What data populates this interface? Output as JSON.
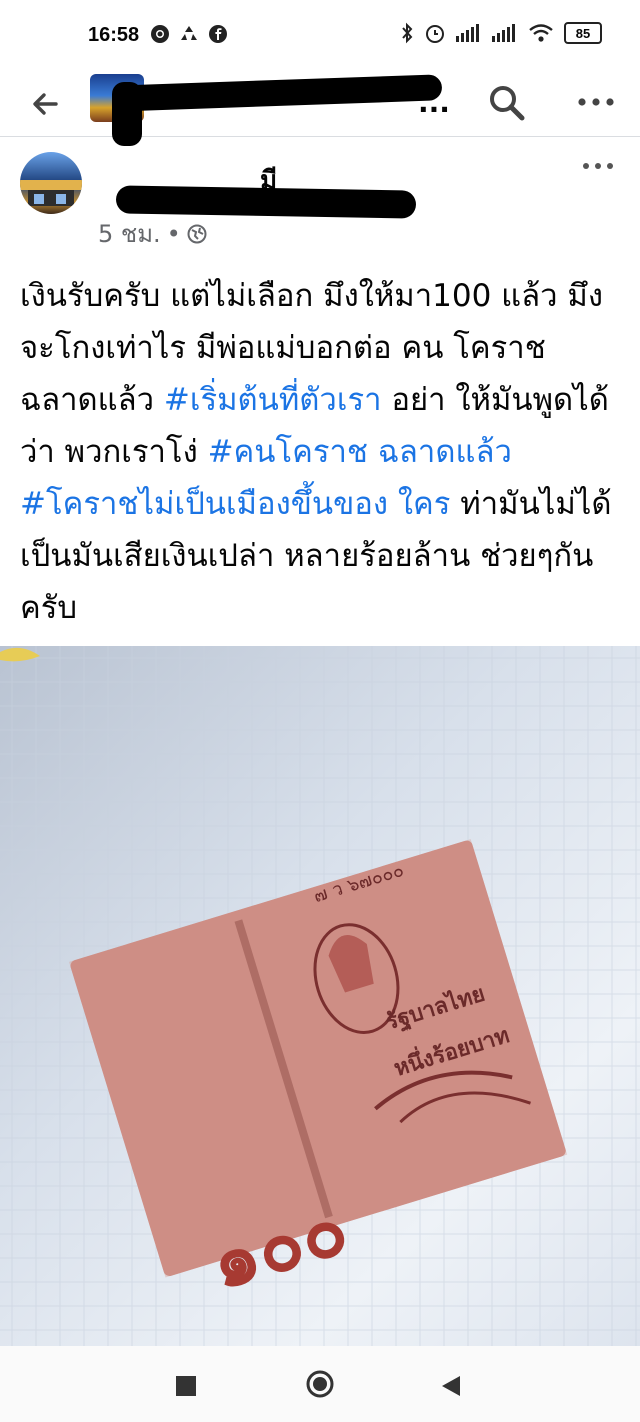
{
  "status_bar": {
    "time": "16:58",
    "battery": "85",
    "left_icons": [
      "chrome-icon",
      "recycle-icon",
      "facebook-icon"
    ],
    "right_icons": [
      "bluetooth-icon",
      "alarm-icon",
      "signal-icon",
      "signal-icon",
      "wifi-icon",
      "battery-icon"
    ]
  },
  "app_bar": {
    "title": "...",
    "back_icon": "arrow-left-icon",
    "search_icon": "search-icon",
    "more_icon": "more-horizontal-icon"
  },
  "post": {
    "author": "มี",
    "time_ago": "5 ชม.",
    "separator": "•",
    "audience_icon": "globe-icon",
    "more_icon": "more-horizontal-icon",
    "text_segments": [
      {
        "text": "เงินรับครับ แต่ไม่เลือก มึงให้มา100 แล้ว มึงจะโกงเท่าไร มีพ่อแม่บอกต่อ คน โคราช ฉลาดแล้ว ",
        "tag": false
      },
      {
        "text": "#เริ่มต้นที่ตัวเรา",
        "tag": true
      },
      {
        "text": "  อย่า ให้มันพูดได้ว่า พวกเราโง่ ",
        "tag": false
      },
      {
        "text": "#คนโคราช ฉลาดแล้ว",
        "tag": true
      },
      {
        "text": " ",
        "tag": false
      },
      {
        "text": "#โคราชไม่เป็นเมืองขึ้นของ ใคร",
        "tag": true
      },
      {
        "text": " ท่ามันไม่ได้เป็นมันเสียเงินเปล่า หลายร้อยล้าน ช่วยๆกันครับ",
        "tag": false
      }
    ],
    "photo": {
      "banknote_numeral": "๑๐๐",
      "banknote_issuer": "รัฐบาลไทย",
      "banknote_value_text": "หนึ่งร้อยบาท",
      "banknote_serial": "๗ ว ๖๗๐๐๐"
    }
  },
  "nav_bar": {
    "recents_icon": "square-icon",
    "home_icon": "circle-icon",
    "back_icon": "triangle-back-icon"
  },
  "colors": {
    "hashtag": "#1b74e4",
    "meta": "#65676b",
    "banknote": "#c9837b"
  }
}
